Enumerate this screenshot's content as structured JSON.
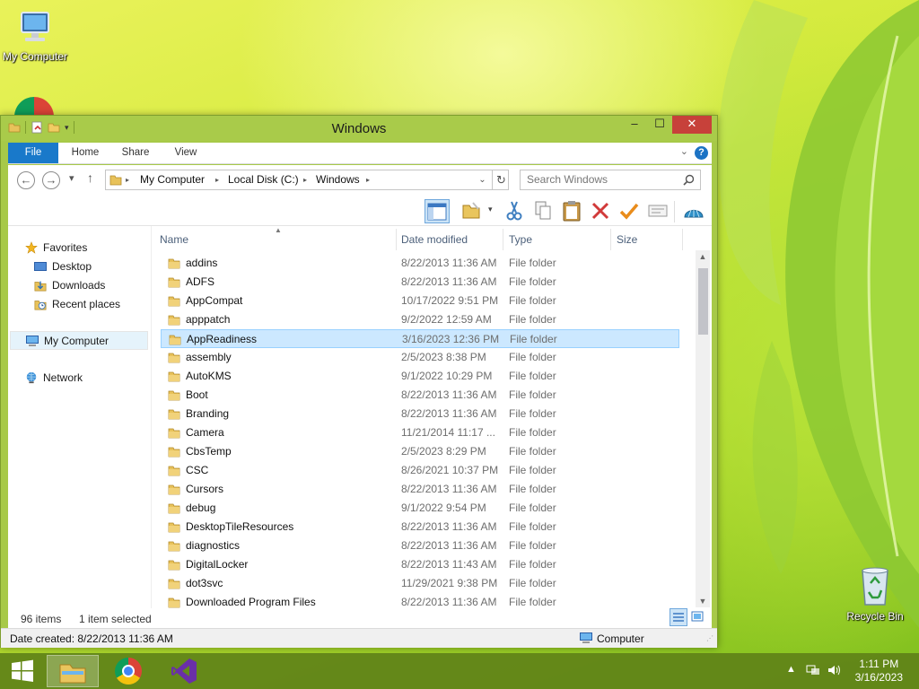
{
  "desktop": {
    "icons": [
      {
        "label": "My Computer",
        "icon": "computer-icon"
      },
      {
        "label": "Recycle Bin",
        "icon": "recycle-bin-icon"
      }
    ]
  },
  "window": {
    "title": "Windows",
    "controls": {
      "minimize": "–",
      "maximize": "☐",
      "close": "✕"
    }
  },
  "ribbon": {
    "tabs": [
      "File",
      "Home",
      "Share",
      "View"
    ],
    "help": "?"
  },
  "address": {
    "crumbs": [
      "My Computer",
      "Local Disk (C:)",
      "Windows"
    ],
    "search_placeholder": "Search Windows"
  },
  "nav_pane": {
    "favorites_label": "Favorites",
    "favorites": [
      "Desktop",
      "Downloads",
      "Recent places"
    ],
    "computer_label": "My Computer",
    "network_label": "Network"
  },
  "columns": [
    "Name",
    "Date modified",
    "Type",
    "Size"
  ],
  "files": [
    {
      "name": "addins",
      "date": "8/22/2013 11:36 AM",
      "type": "File folder"
    },
    {
      "name": "ADFS",
      "date": "8/22/2013 11:36 AM",
      "type": "File folder"
    },
    {
      "name": "AppCompat",
      "date": "10/17/2022 9:51 PM",
      "type": "File folder"
    },
    {
      "name": "apppatch",
      "date": "9/2/2022 12:59 AM",
      "type": "File folder"
    },
    {
      "name": "AppReadiness",
      "date": "3/16/2023 12:36 PM",
      "type": "File folder",
      "selected": true
    },
    {
      "name": "assembly",
      "date": "2/5/2023 8:38 PM",
      "type": "File folder"
    },
    {
      "name": "AutoKMS",
      "date": "9/1/2022 10:29 PM",
      "type": "File folder"
    },
    {
      "name": "Boot",
      "date": "8/22/2013 11:36 AM",
      "type": "File folder"
    },
    {
      "name": "Branding",
      "date": "8/22/2013 11:36 AM",
      "type": "File folder"
    },
    {
      "name": "Camera",
      "date": "11/21/2014 11:17 ...",
      "type": "File folder"
    },
    {
      "name": "CbsTemp",
      "date": "2/5/2023 8:29 PM",
      "type": "File folder"
    },
    {
      "name": "CSC",
      "date": "8/26/2021 10:37 PM",
      "type": "File folder"
    },
    {
      "name": "Cursors",
      "date": "8/22/2013 11:36 AM",
      "type": "File folder"
    },
    {
      "name": "debug",
      "date": "9/1/2022 9:54 PM",
      "type": "File folder"
    },
    {
      "name": "DesktopTileResources",
      "date": "8/22/2013 11:36 AM",
      "type": "File folder"
    },
    {
      "name": "diagnostics",
      "date": "8/22/2013 11:36 AM",
      "type": "File folder"
    },
    {
      "name": "DigitalLocker",
      "date": "8/22/2013 11:43 AM",
      "type": "File folder"
    },
    {
      "name": "dot3svc",
      "date": "11/29/2021 9:38 PM",
      "type": "File folder"
    },
    {
      "name": "Downloaded Program Files",
      "date": "8/22/2013 11:36 AM",
      "type": "File folder"
    }
  ],
  "status": {
    "items": "96 items",
    "selected": "1 item selected"
  },
  "details": {
    "date_created": "Date created: 8/22/2013 11:36 AM",
    "location": "Computer"
  },
  "taskbar": {
    "time": "1:11 PM",
    "date": "3/16/2023"
  },
  "colors": {
    "accent": "#1979ca",
    "window_frame": "#a9cb4a",
    "selection": "#cce8ff",
    "close_button": "#c7413a"
  }
}
